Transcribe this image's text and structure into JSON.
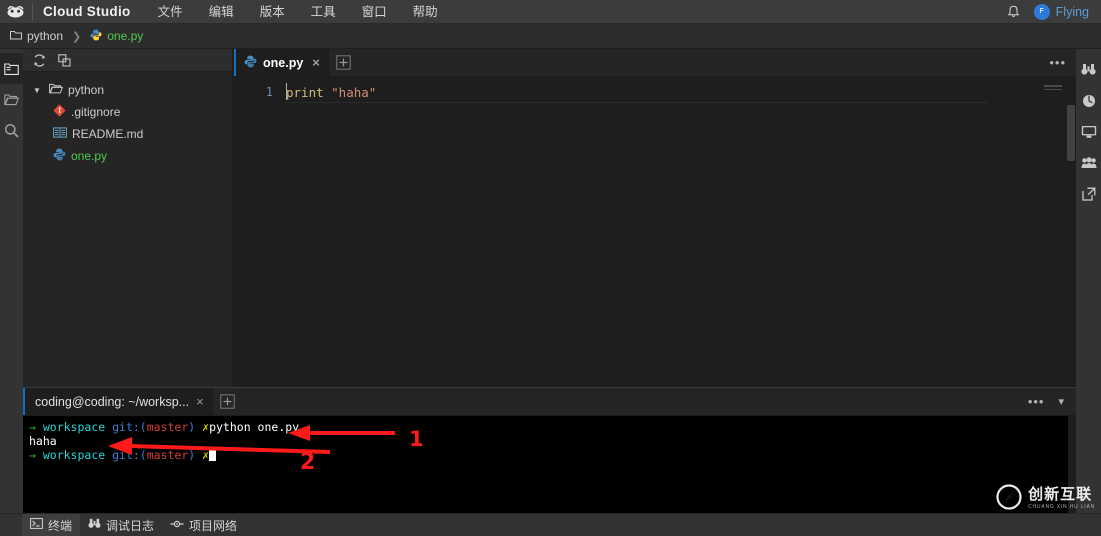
{
  "titlebar": {
    "app_name": "Cloud Studio",
    "logo_icon": "cloud-studio-logo-icon",
    "menu": [
      {
        "label": "文件",
        "name": "menu-file"
      },
      {
        "label": "编辑",
        "name": "menu-edit"
      },
      {
        "label": "版本",
        "name": "menu-version"
      },
      {
        "label": "工具",
        "name": "menu-tools"
      },
      {
        "label": "窗口",
        "name": "menu-window"
      },
      {
        "label": "帮助",
        "name": "menu-help"
      }
    ],
    "bell_icon": "notification-bell-icon",
    "avatar_initial": "F",
    "user_name": "Flying"
  },
  "breadcrumb": {
    "root": "python",
    "root_icon": "folder-icon",
    "separator": "❯",
    "file": "one.py",
    "file_icon": "python-file-icon"
  },
  "activitybar": {
    "items": [
      {
        "name": "activity-explorer",
        "icon": "file-tree-icon",
        "active": true
      },
      {
        "name": "activity-open-folder",
        "icon": "open-folder-icon",
        "active": false
      },
      {
        "name": "activity-search",
        "icon": "search-icon",
        "active": false
      }
    ]
  },
  "explorer": {
    "header_icons": [
      {
        "name": "refresh-icon",
        "icon": "refresh-icon"
      },
      {
        "name": "collapse-all-icon",
        "icon": "collapse-all-icon"
      }
    ],
    "tree": [
      {
        "label": "python",
        "icon": "folder-open-icon",
        "depth": 0,
        "expanded": true,
        "color": "default"
      },
      {
        "label": ".gitignore",
        "icon": "git-icon",
        "depth": 1,
        "color": "default"
      },
      {
        "label": "README.md",
        "icon": "markdown-icon",
        "depth": 1,
        "color": "default"
      },
      {
        "label": "one.py",
        "icon": "python-file-icon",
        "depth": 1,
        "color": "green"
      }
    ]
  },
  "editor": {
    "tab": {
      "label": "one.py",
      "icon": "python-file-icon",
      "close_label": "×"
    },
    "add_tab_label": "+",
    "more_actions_label": "•••",
    "lines": [
      {
        "number": "1",
        "tokens": [
          {
            "text": "print ",
            "type": "keyword"
          },
          {
            "text": "\"haha\"",
            "type": "string"
          }
        ]
      }
    ]
  },
  "panel": {
    "tab": {
      "label": "coding@coding: ~/worksp...",
      "close_label": "×"
    },
    "add_tab_label": "+",
    "more_actions_label": "•••",
    "collapse_label": "▾",
    "terminal_lines": [
      {
        "segments": [
          {
            "text": "→ ",
            "color": "green"
          },
          {
            "text": "workspace ",
            "color": "cyan"
          },
          {
            "text": "git:(",
            "color": "blue"
          },
          {
            "text": "master",
            "color": "red"
          },
          {
            "text": ") ",
            "color": "blue"
          },
          {
            "text": "✗",
            "color": "yellow"
          },
          {
            "text": "python one.py",
            "color": "white"
          }
        ]
      },
      {
        "segments": [
          {
            "text": "haha",
            "color": "white"
          }
        ]
      },
      {
        "segments": [
          {
            "text": "→ ",
            "color": "green"
          },
          {
            "text": "workspace ",
            "color": "cyan"
          },
          {
            "text": "git:(",
            "color": "blue"
          },
          {
            "text": "master",
            "color": "red"
          },
          {
            "text": ") ",
            "color": "blue"
          },
          {
            "text": "✗",
            "color": "yellow"
          }
        ],
        "cursor": true
      }
    ]
  },
  "rightbar": {
    "items": [
      {
        "name": "right-binoculars",
        "icon": "binoculars-icon"
      },
      {
        "name": "right-globe",
        "icon": "globe-icon"
      },
      {
        "name": "right-monitor",
        "icon": "monitor-icon"
      },
      {
        "name": "right-team",
        "icon": "team-icon"
      },
      {
        "name": "right-external-link",
        "icon": "external-link-icon"
      }
    ]
  },
  "statusbar": {
    "items": [
      {
        "label": "终端",
        "icon": "terminal-icon",
        "name": "status-terminal",
        "active": true
      },
      {
        "label": "调试日志",
        "icon": "binoculars-icon",
        "name": "status-debug-log",
        "active": false
      },
      {
        "label": "项目网络",
        "icon": "network-icon",
        "name": "status-project-network",
        "active": false
      }
    ]
  },
  "annotations": [
    {
      "label": "1",
      "name": "annotation-1",
      "target": "python one.py command"
    },
    {
      "label": "2",
      "name": "annotation-2",
      "target": "haha output"
    }
  ],
  "watermark": {
    "text": "创新互联",
    "subtext": "CHUANG XIN HU LIAN",
    "logo_icon": "watermark-logo-icon"
  },
  "colors": {
    "accent": "#0e70c0",
    "green_file": "#4ec94e",
    "annotation_red": "#ff1a1a",
    "keyword": "#d7ba7d",
    "string": "#ce9178"
  }
}
